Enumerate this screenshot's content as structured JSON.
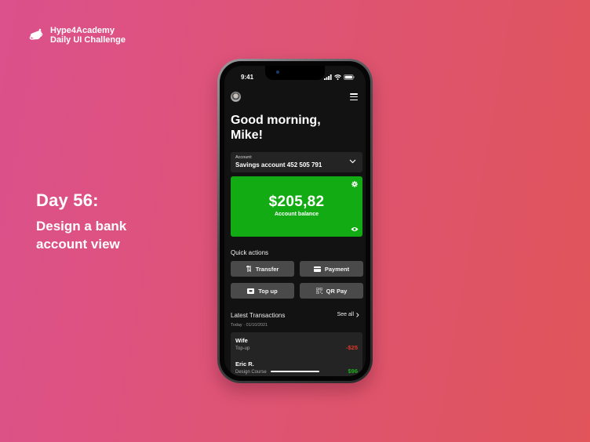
{
  "brand": {
    "line1": "Hype4Academy",
    "line2": "Daily UI Challenge",
    "icon": "rocket-logo-icon"
  },
  "headline": {
    "day": "Day 56:",
    "desc_line1": "Design a bank",
    "desc_line2": "account view"
  },
  "phone": {
    "status": {
      "time": "9:41",
      "icons": [
        "signal-icon",
        "wifi-icon",
        "battery-icon"
      ]
    },
    "greeting_line1": "Good morning,",
    "greeting_line2": "Mike!",
    "account": {
      "label": "Account:",
      "value": "Savings account 452 505 791"
    },
    "balance": {
      "amount": "$205,82",
      "caption": "Account balance",
      "color": "#13ab13"
    },
    "quick_actions": {
      "title": "Quick actions",
      "items": [
        {
          "label": "Transfer",
          "icon": "transfer-icon"
        },
        {
          "label": "Payment",
          "icon": "card-icon"
        },
        {
          "label": "Top up",
          "icon": "wallet-icon"
        },
        {
          "label": "QR Pay",
          "icon": "qr-icon"
        }
      ]
    },
    "transactions": {
      "title": "Latest Transactions",
      "see_all": "See all",
      "date_label": "Today · 01/10/2021",
      "items": [
        {
          "name": "Wife",
          "sub": "Top-up",
          "amount": "-$25",
          "color": "#e0392b"
        },
        {
          "name": "Eric R.",
          "sub": "Design Course",
          "amount": "$96",
          "color": "#1fae1f"
        }
      ]
    }
  }
}
